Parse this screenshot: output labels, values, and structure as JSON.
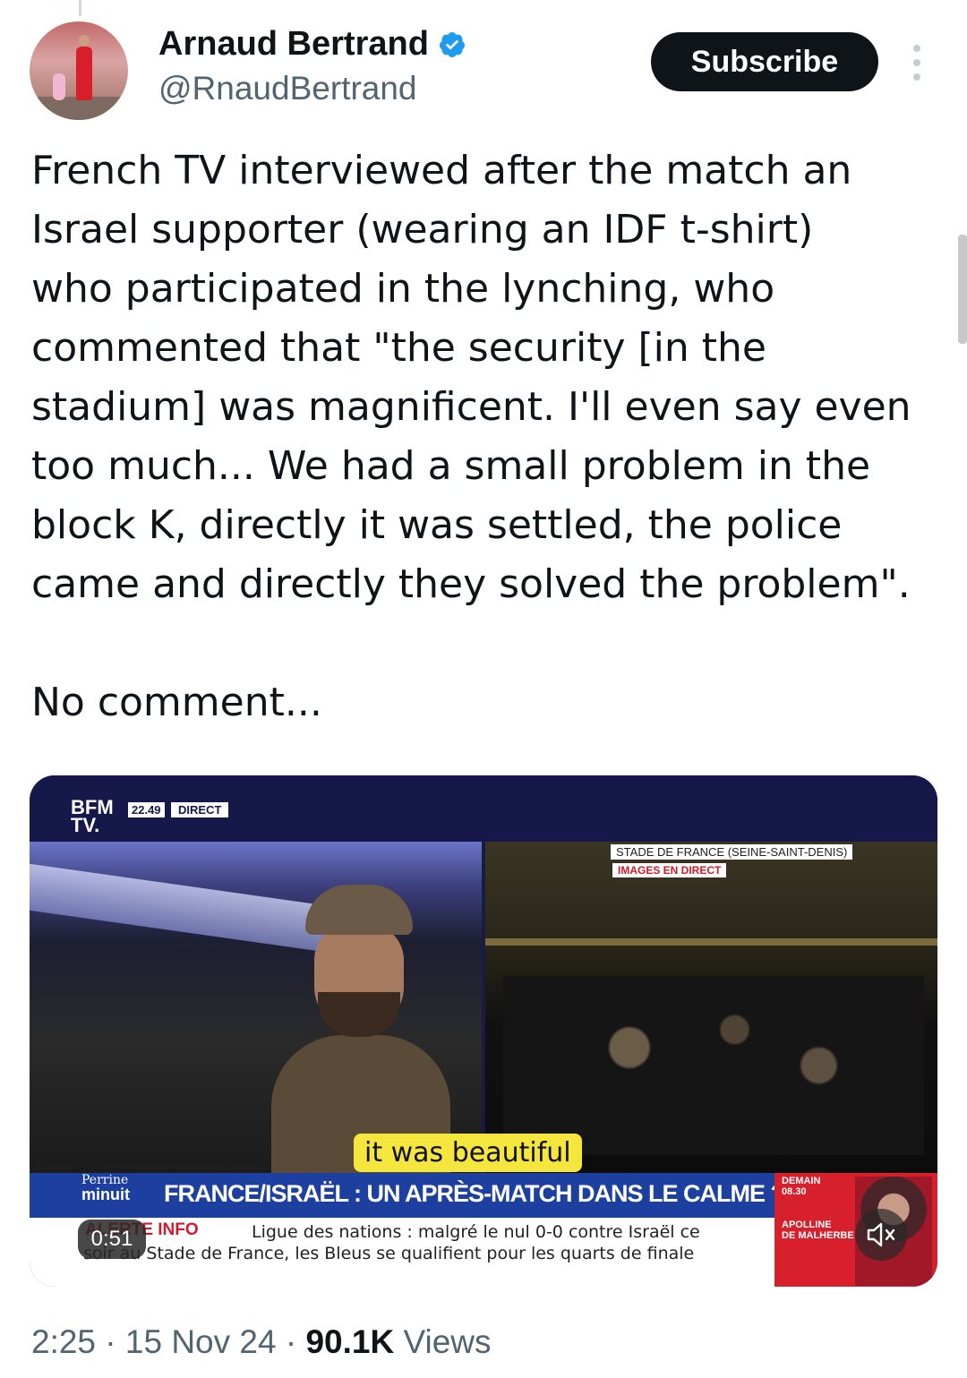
{
  "author": {
    "name": "Arnaud Bertrand",
    "handle": "@RnaudBertrand",
    "verified": true
  },
  "actions": {
    "subscribe_label": "Subscribe"
  },
  "tweet": {
    "paragraphs": [
      "French TV interviewed after the match an\nIsrael supporter (wearing an IDF t-shirt)\nwho participated in the lynching, who\ncommented that \"the security [in the\nstadium] was magnificent. I'll even say even\ntoo much... We had a small problem in the\nblock K, directly it was settled, the police\ncame and directly they solved the problem\".",
      "No comment..."
    ]
  },
  "video": {
    "duration": "0:51",
    "overlay": {
      "channel": "BFM\nTV.",
      "time": "22.49",
      "live": "DIRECT",
      "location": "STADE DE FRANCE (SEINE-SAINT-DENIS)",
      "live_images": "IMAGES EN DIRECT",
      "subtitle": "it was beautiful",
      "program": "Perrine",
      "program_2": "minuit",
      "headline": "FRANCE/ISRAËL : UN APRÈS-MATCH DANS LE CALME ?",
      "alert_label": "ALERTE INFO",
      "ticker_line1": "Ligue des nations : malgré le nul 0-0 contre Israël ce",
      "ticker_line2": "soir au Stade de France, les Bleus se qualifient pour les quarts de finale",
      "next_label": "DEMAIN",
      "next_time": "08.30",
      "next_show": "APOLLINE\nDE MALHERBE"
    }
  },
  "meta": {
    "time": "2:25",
    "date": "15 Nov 24",
    "views_count": "90.1K",
    "views_label": "Views"
  },
  "colors": {
    "verified": "#1d9bf0",
    "secondary_text": "#536471",
    "subscribe_bg": "#0f1419"
  }
}
